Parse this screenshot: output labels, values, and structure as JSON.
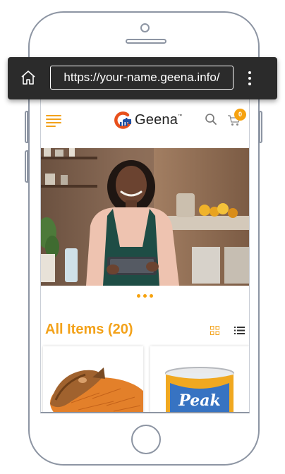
{
  "browser": {
    "url": "https://your-name.geena.info/"
  },
  "header": {
    "brand_name": "Geena",
    "brand_tm": "™",
    "cart_count": "0"
  },
  "carousel": {
    "active_dot": 0,
    "dot_count": 3
  },
  "section": {
    "title": "All Items (20)"
  },
  "products": [
    {
      "image": "jollof-rice-with-fish"
    },
    {
      "image": "peak-milk-can",
      "label": "Peak"
    }
  ],
  "colors": {
    "accent": "#f3a21a",
    "badge": "#f6a20f",
    "browser_bar": "#2b2b2b",
    "frame": "#8d95a3"
  }
}
